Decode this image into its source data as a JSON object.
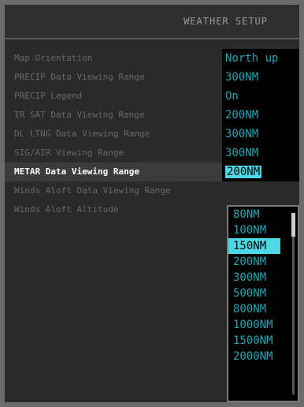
{
  "title": "WEATHER SETUP",
  "settings": [
    {
      "label": "Map Orientation",
      "value": "North up"
    },
    {
      "label": "PRECIP Data Viewing Range",
      "value": "300NM"
    },
    {
      "label": "PRECIP Legend",
      "value": "On"
    },
    {
      "label": "IR SAT Data Viewing Range",
      "value": "200NM"
    },
    {
      "label": "DL LTNG Data Viewing Range",
      "value": "300NM"
    },
    {
      "label": "SIG/AIR Viewing Range",
      "value": "300NM"
    },
    {
      "label": "METAR Data Viewing Range",
      "value": "200NM"
    },
    {
      "label": "Winds Aloft Data Viewing Range",
      "value": ""
    },
    {
      "label": "Winds Aloft Altitude",
      "value": ""
    }
  ],
  "dropdown_options": [
    "80NM",
    "100NM",
    "150NM",
    "200NM",
    "300NM",
    "500NM",
    "800NM",
    "1000NM",
    "1500NM",
    "2000NM"
  ],
  "dropdown_highlighted": "150NM",
  "colors": {
    "value_text": "#1aa7b8",
    "highlight": "#4dd8e6"
  }
}
